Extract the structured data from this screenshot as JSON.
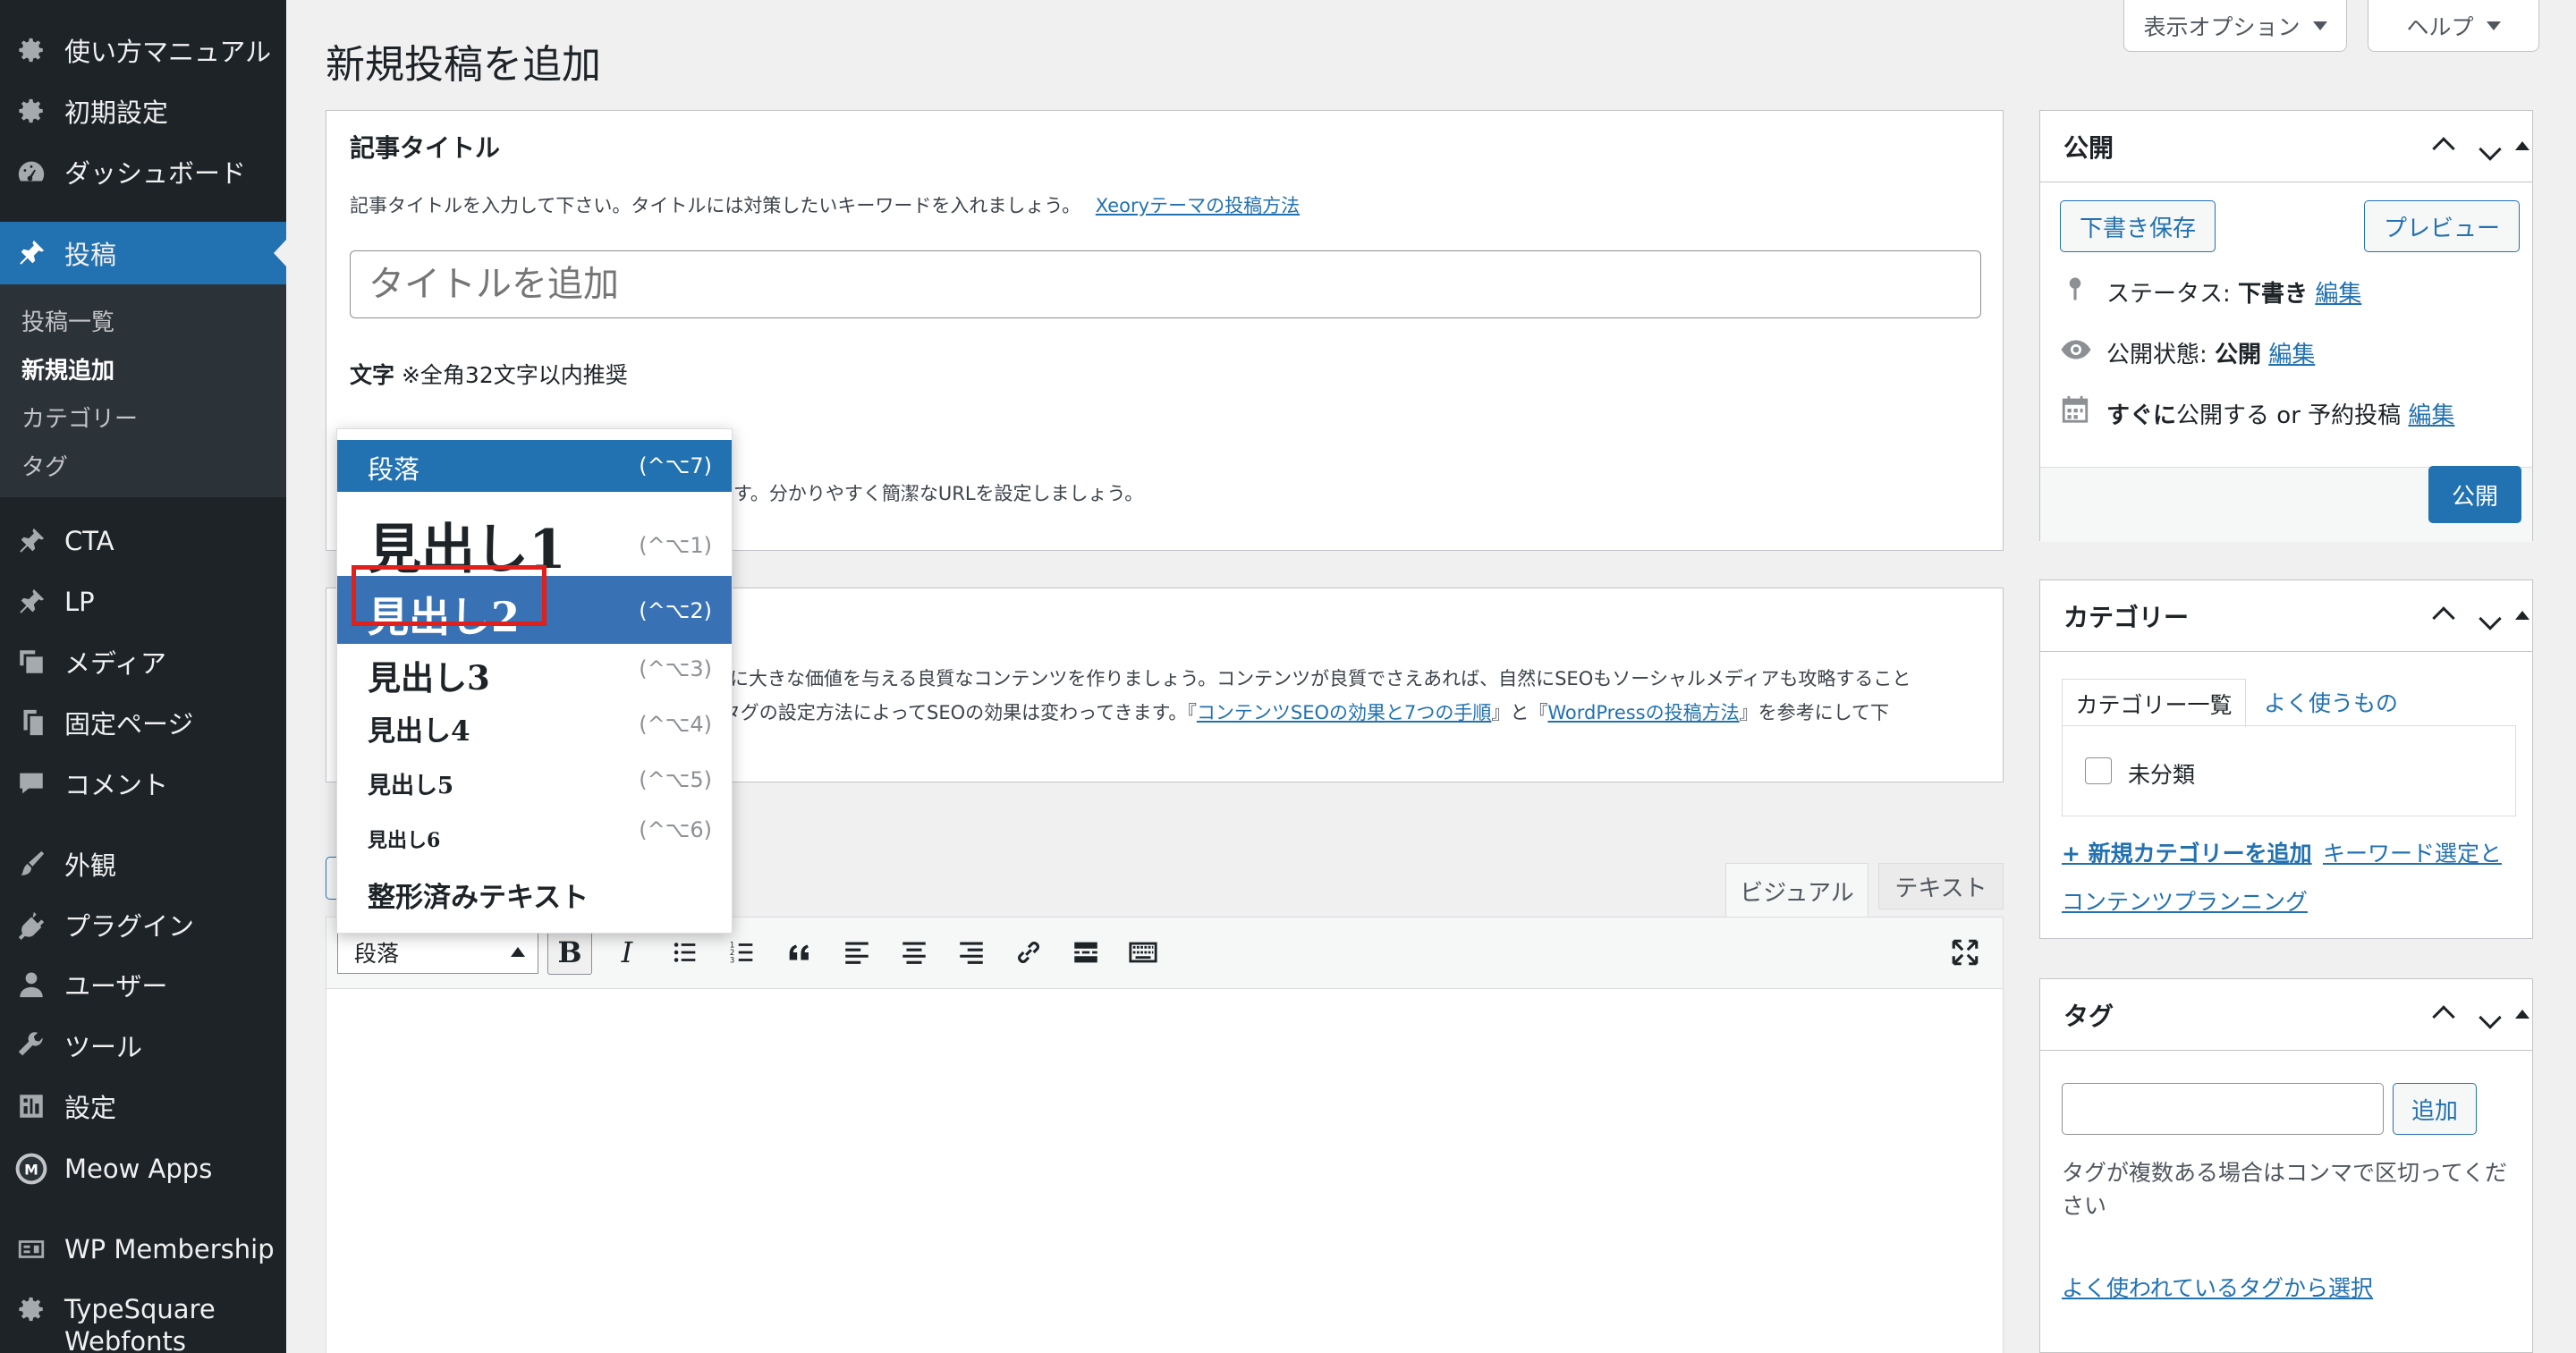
{
  "sidebar": {
    "items": [
      {
        "label": "使い方マニュアル",
        "icon": "gear-icon"
      },
      {
        "label": "初期設定",
        "icon": "gear-icon"
      },
      {
        "label": "ダッシュボード",
        "icon": "dashboard-icon"
      },
      {
        "label": "投稿",
        "icon": "pin-icon"
      },
      {
        "label": "CTA",
        "icon": "pin-icon"
      },
      {
        "label": "LP",
        "icon": "pin-icon"
      },
      {
        "label": "メディア",
        "icon": "media-icon"
      },
      {
        "label": "固定ページ",
        "icon": "page-icon"
      },
      {
        "label": "コメント",
        "icon": "comment-icon"
      },
      {
        "label": "外観",
        "icon": "brush-icon"
      },
      {
        "label": "プラグイン",
        "icon": "plugin-icon"
      },
      {
        "label": "ユーザー",
        "icon": "user-icon"
      },
      {
        "label": "ツール",
        "icon": "wrench-icon"
      },
      {
        "label": "設定",
        "icon": "settings-icon"
      },
      {
        "label": "Meow Apps",
        "icon": "meow-apps-icon"
      },
      {
        "label": "WP Membership",
        "icon": "membership-icon"
      },
      {
        "label": "TypeSquare",
        "icon": "gear-icon"
      }
    ],
    "typesquare_sub": "Webfonts",
    "submenu": [
      "投稿一覧",
      "新規追加",
      "カテゴリー",
      "タグ"
    ]
  },
  "header": {
    "title": "新規投稿を追加",
    "display_options": "表示オプション",
    "help": "ヘルプ"
  },
  "title_box": {
    "heading": "記事タイトル",
    "description": "記事タイトルを入力して下さい。タイトルには対策したいキーワードを入れましょう。",
    "link": "Xeoryテーマの投稿方法",
    "placeholder": "タイトルを追加",
    "char_label": "文字",
    "char_note": "※全角32文字以内推奨",
    "url_note": "す。分かりやすく簡潔なURLを設定しましょう。"
  },
  "content_box": {
    "line1": "ーに大きな価値を与える良質なコンテンツを作りましょう。コンテンツが良質でさえあれば、自然にSEOもソーシャルメディアも攻略すること",
    "line2_a": "Lタグの設定方法によってSEOの効果は変わってきます。『",
    "link1": "コンテンツSEOの効果と7つの手順",
    "line2_b": "』と『",
    "link2": "WordPressの投稿方法",
    "line2_c": "』を参考にして下"
  },
  "editor": {
    "tab_visual": "ビジュアル",
    "tab_text": "テキスト",
    "format_value": "段落"
  },
  "format_dropdown": [
    {
      "label": "段落",
      "shortcut": "(^⌥7)"
    },
    {
      "label": "見出し1",
      "shortcut": "(^⌥1)"
    },
    {
      "label": "見出し2",
      "shortcut": "(^⌥2)"
    },
    {
      "label": "見出し3",
      "shortcut": "(^⌥3)"
    },
    {
      "label": "見出し4",
      "shortcut": "(^⌥4)"
    },
    {
      "label": "見出し5",
      "shortcut": "(^⌥5)"
    },
    {
      "label": "見出し6",
      "shortcut": "(^⌥6)"
    },
    {
      "label": "整形済みテキスト",
      "shortcut": ""
    }
  ],
  "publish": {
    "title": "公開",
    "save_draft": "下書き保存",
    "preview": "プレビュー",
    "status_label": "ステータス:",
    "status_value": "下書き",
    "edit": "編集",
    "visibility_label": "公開状態:",
    "visibility_value": "公開",
    "schedule_a": "すぐに",
    "schedule_b": "公開する or 予約投稿",
    "publish_btn": "公開"
  },
  "category": {
    "title": "カテゴリー",
    "tab_all": "カテゴリー一覧",
    "tab_popular": "よく使うもの",
    "item": "未分類",
    "add_link": "+ 新規カテゴリーを追加",
    "link2a": "キーワード選定と",
    "link2b": "コンテンツプランニング"
  },
  "tags": {
    "title": "タグ",
    "add": "追加",
    "hint": "タグが複数ある場合はコンマで区切ってください",
    "choose": "よく使われているタグから選択"
  },
  "colors": {
    "accent": "#2271b1",
    "sidebar": "#1d2327",
    "highlight": "#e0201c"
  }
}
